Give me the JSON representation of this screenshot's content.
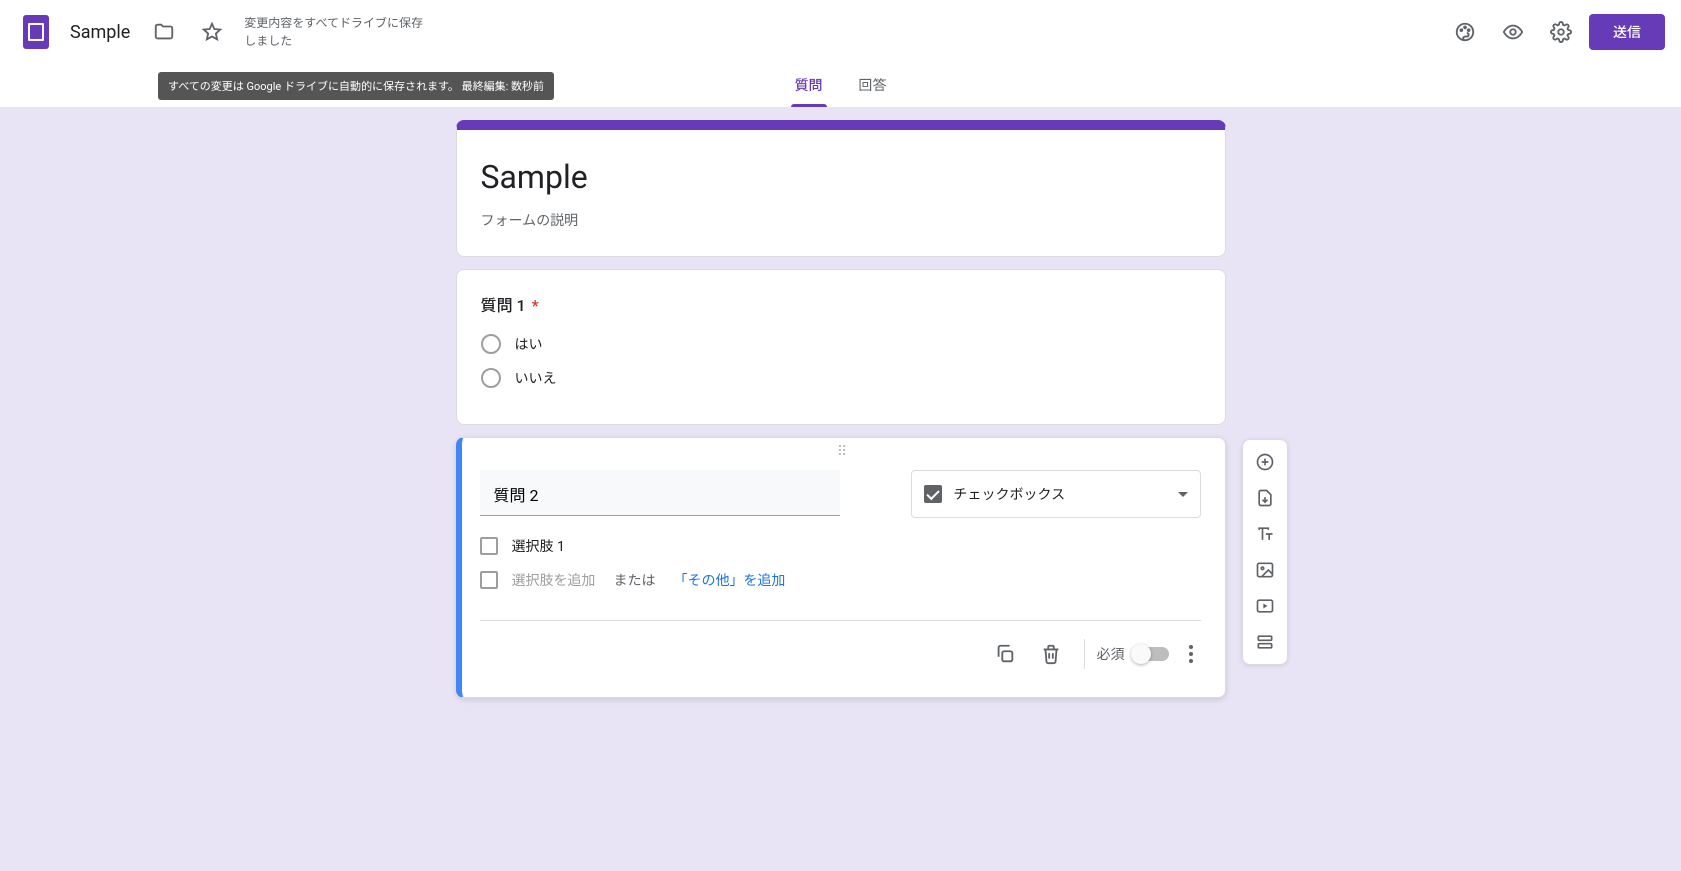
{
  "header": {
    "doc_title": "Sample",
    "save_status": "変更内容をすべてドライブに保存しました",
    "tooltip": "すべての変更は Google ドライブに自動的に保存されます。 最終編集: 数秒前",
    "send_label": "送信"
  },
  "tabs": {
    "questions": "質問",
    "responses": "回答"
  },
  "form": {
    "title": "Sample",
    "description": "フォームの説明"
  },
  "q1": {
    "title": "質問 1",
    "required_mark": "*",
    "opt1": "はい",
    "opt2": "いいえ"
  },
  "q2": {
    "title_value": "質問 2",
    "type_label": "チェックボックス",
    "opt1": "選択肢 1",
    "add_option": "選択肢を追加",
    "or": "または",
    "add_other": "「その他」を追加",
    "required_label": "必須"
  }
}
